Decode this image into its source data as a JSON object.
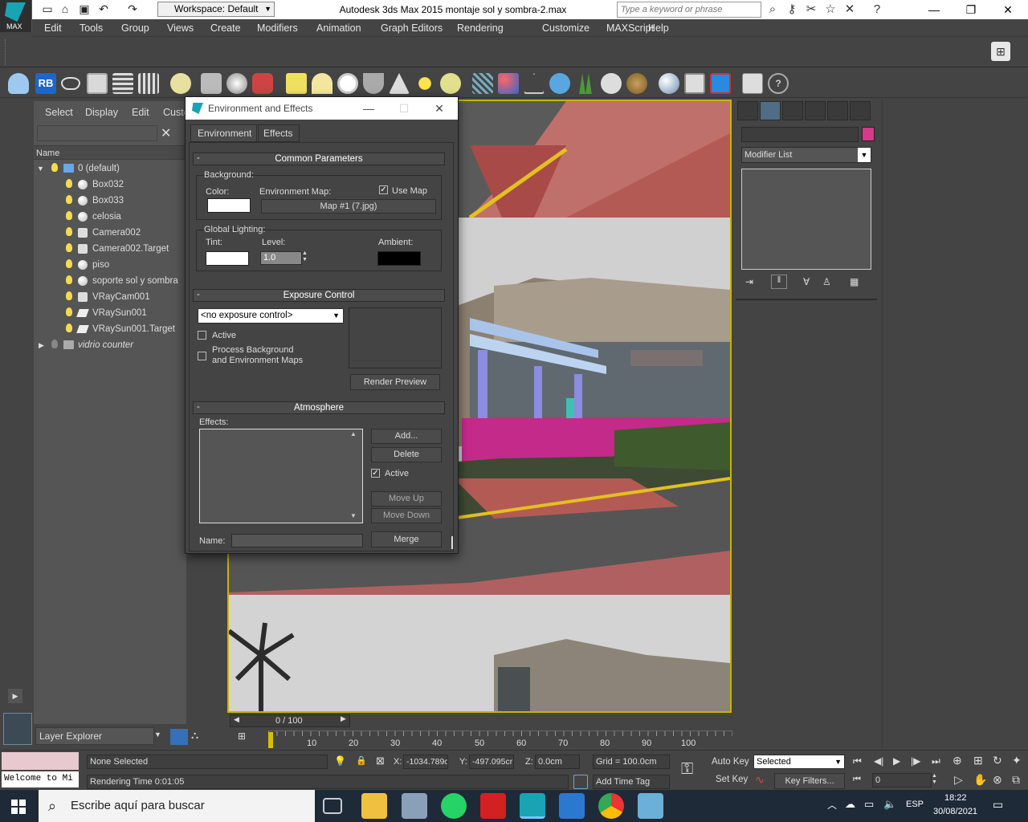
{
  "window": {
    "app_title": "Autodesk 3ds Max  2015      montaje sol y sombra-2.max",
    "logo_label": "MAX",
    "workspace": "Workspace: Default",
    "keyword_placeholder": "Type a keyword or phrase",
    "controls": [
      "—",
      "❐",
      "✕"
    ]
  },
  "menus": [
    "Edit",
    "Tools",
    "Group",
    "Views",
    "Create",
    "Modifiers",
    "Animation",
    "Graph Editors",
    "Rendering",
    "Customize",
    "MAXScript",
    "Help"
  ],
  "toolbar": {
    "rb_label": "RB"
  },
  "scene_explorer": {
    "tabs": [
      "Select",
      "Display",
      "Edit",
      "Custo"
    ],
    "name_header": "Name",
    "items": [
      {
        "label": "0 (default)"
      },
      {
        "label": "Box032"
      },
      {
        "label": "Box033"
      },
      {
        "label": "celosia"
      },
      {
        "label": "Camera002"
      },
      {
        "label": "Camera002.Target"
      },
      {
        "label": "piso"
      },
      {
        "label": "soporte sol y sombra"
      },
      {
        "label": "VRayCam001"
      },
      {
        "label": "VRaySun001"
      },
      {
        "label": "VRaySun001.Target"
      },
      {
        "label": "vidrio counter"
      }
    ],
    "layer_explorer": "Layer Explorer"
  },
  "dialog": {
    "title": "Environment and Effects",
    "tabs": [
      "Environment",
      "Effects"
    ],
    "common": {
      "header": "Common Parameters",
      "background": "Background:",
      "color": "Color:",
      "env_map": "Environment Map:",
      "use_map": "Use Map",
      "map_button": "Map #1 (7.jpg)",
      "global_lighting": "Global Lighting:",
      "tint": "Tint:",
      "level": "Level:",
      "level_value": "1.0",
      "ambient": "Ambient:",
      "bg_color": "#ffffff",
      "tint_color": "#ffffff",
      "ambient_color": "#000000"
    },
    "exposure": {
      "header": "Exposure Control",
      "select": "<no exposure control>",
      "active": "Active",
      "process_bg_1": "Process Background",
      "process_bg_2": "and Environment Maps",
      "render_preview": "Render Preview"
    },
    "atmosphere": {
      "header": "Atmosphere",
      "effects": "Effects:",
      "add": "Add...",
      "delete": "Delete",
      "active": "Active",
      "move_up": "Move Up",
      "move_down": "Move Down",
      "name": "Name:",
      "merge": "Merge"
    }
  },
  "command_panel": {
    "modifier_list": "Modifier List",
    "object_color": "#d63a8a"
  },
  "timeline": {
    "frame": "0 / 100",
    "ticks": [
      "10",
      "20",
      "30",
      "40",
      "50",
      "60",
      "70",
      "80",
      "90",
      "100"
    ]
  },
  "status": {
    "welcome": "Welcome to Mi",
    "none_selected": "None Selected",
    "render_time": "Rendering Time  0:01:05",
    "x_label": "X:",
    "x_value": "-1034.789c",
    "y_label": "Y:",
    "y_value": "-497.095cr",
    "z_label": "Z:",
    "z_value": "0.0cm",
    "grid": "Grid = 100.0cm",
    "add_time_tag": "Add Time Tag",
    "auto_key": "Auto Key",
    "set_key": "Set Key",
    "selected": "Selected",
    "key_filters": "Key Filters...",
    "frame_value": "0"
  },
  "taskbar": {
    "search": "Escribe aquí para buscar",
    "lang": "ESP",
    "time": "18:22",
    "date": "30/08/2021"
  }
}
